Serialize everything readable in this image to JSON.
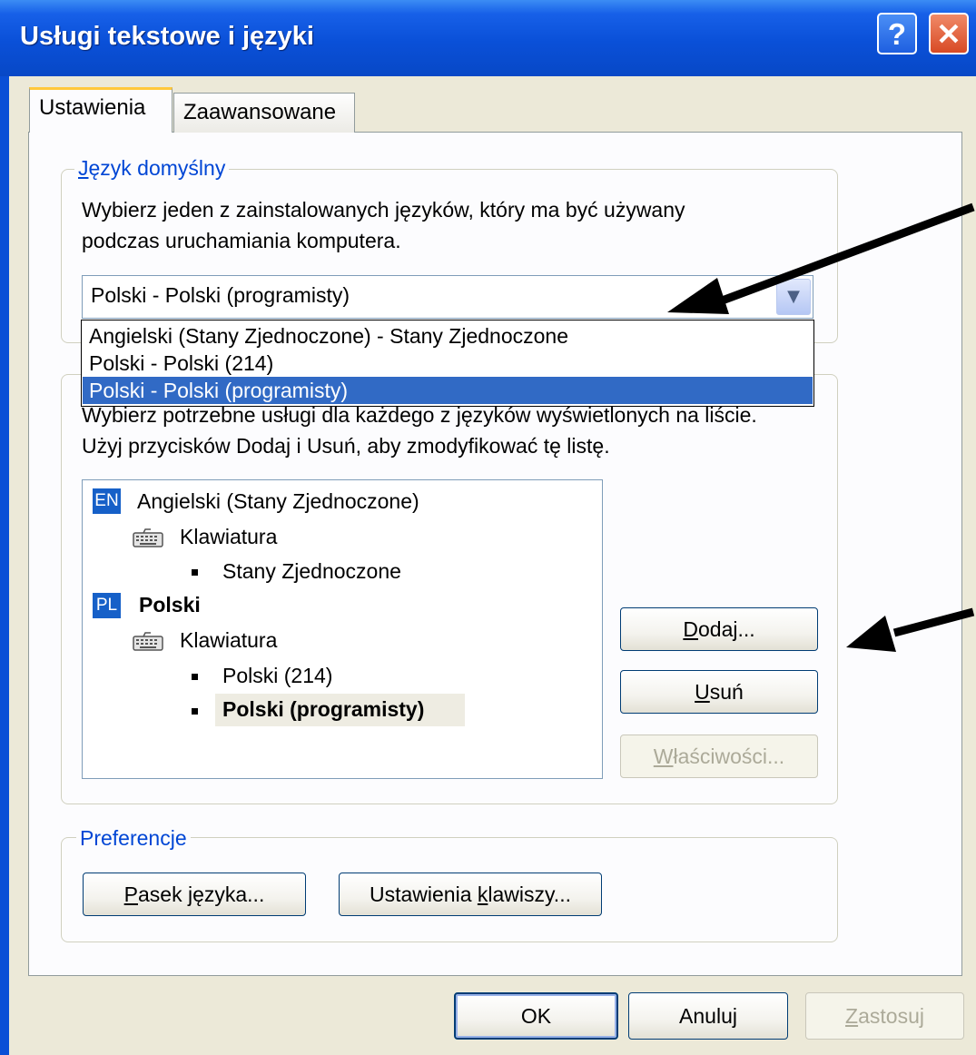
{
  "window": {
    "title": "Usługi tekstowe i języki",
    "help_glyph": "?",
    "close_glyph": "✕"
  },
  "tabs": [
    {
      "label": "Ustawienia",
      "active": true
    },
    {
      "label": "Zaawansowane",
      "active": false
    }
  ],
  "default_language": {
    "legend": "Język domyślny",
    "description_line1": "Wybierz jeden z zainstalowanych języków, który ma być używany",
    "description_line2": "podczas uruchamiania komputera.",
    "selected_value": "Polski - Polski (programisty)",
    "options": [
      "Angielski (Stany Zjednoczone) - Stany Zjednoczone",
      "Polski - Polski (214)",
      "Polski - Polski (programisty)"
    ],
    "highlighted_option_index": 2
  },
  "services": {
    "description_line1": "Wybierz potrzebne usługi dla każdego z języków wyświetlonych na liście.",
    "description_line2": "Użyj przycisków Dodaj i Usuń, aby zmodyfikować tę listę.",
    "tree": {
      "en": {
        "badge": "EN",
        "language": "Angielski (Stany Zjednoczone)",
        "category": "Klawiatura",
        "layouts": [
          "Stany Zjednoczone"
        ]
      },
      "pl": {
        "badge": "PL",
        "language": "Polski",
        "category": "Klawiatura",
        "layouts": [
          "Polski (214)",
          "Polski (programisty)"
        ]
      }
    },
    "buttons": {
      "add": {
        "underlined": "D",
        "rest": "odaj..."
      },
      "remove": {
        "underlined": "U",
        "rest": "suń"
      },
      "properties": {
        "underlined": "W",
        "rest": "łaściwości...",
        "disabled": true
      }
    }
  },
  "preferences": {
    "legend": "Preferencje",
    "language_bar": {
      "underlined": "P",
      "rest": "asek języka..."
    },
    "key_settings": {
      "prefix": "Ustawienia ",
      "underlined": "k",
      "rest": "lawiszy..."
    }
  },
  "footer": {
    "ok": "OK",
    "cancel": "Anuluj",
    "apply": {
      "underlined": "Z",
      "rest": "astosuj",
      "disabled": true
    }
  },
  "colors": {
    "title_bar": "#0a50d8",
    "dialog_face": "#ece9d8",
    "legend_text": "#0046d5",
    "selection": "#316ac5",
    "arrow": "#000000"
  }
}
